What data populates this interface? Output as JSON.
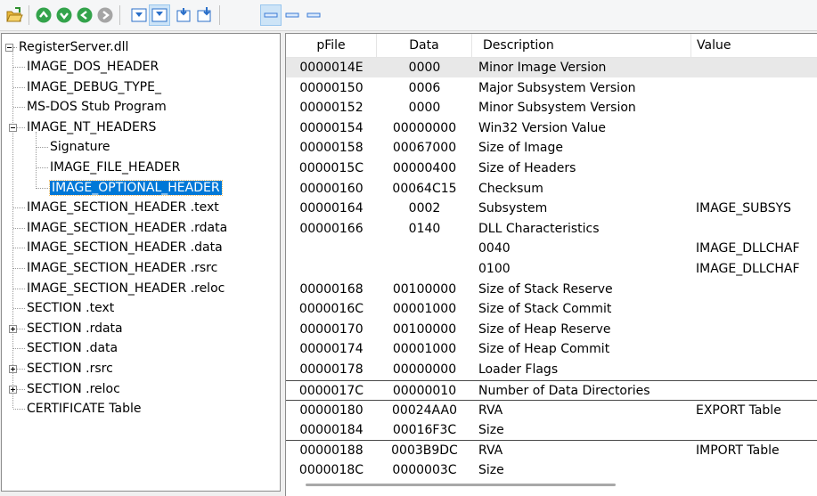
{
  "toolbar": {
    "buttons": [
      {
        "name": "open-folder-icon"
      },
      {
        "name": "nav-first-icon",
        "color": "#2ea043"
      },
      {
        "name": "nav-back-icon",
        "color": "#2ea043"
      },
      {
        "name": "nav-forward-icon",
        "color": "#2ea043"
      },
      {
        "name": "nav-last-icon",
        "color": "#9e9e9e"
      },
      {
        "name": "view-list-icon"
      },
      {
        "name": "view-detail-icon"
      },
      {
        "name": "view-hex-icon"
      },
      {
        "name": "view-download-icon"
      },
      {
        "name": "view-bytes-icon"
      },
      {
        "name": "view-word-icon"
      },
      {
        "name": "view-dword-icon"
      }
    ]
  },
  "tree": {
    "root": "RegisterServer.dll",
    "items": [
      {
        "label": "IMAGE_DOS_HEADER"
      },
      {
        "label": "IMAGE_DEBUG_TYPE_"
      },
      {
        "label": "MS-DOS Stub Program"
      },
      {
        "label": "IMAGE_NT_HEADERS",
        "expanded": true
      },
      {
        "label": "Signature"
      },
      {
        "label": "IMAGE_FILE_HEADER"
      },
      {
        "label": "IMAGE_OPTIONAL_HEADER",
        "selected": true
      },
      {
        "label": "IMAGE_SECTION_HEADER .text"
      },
      {
        "label": "IMAGE_SECTION_HEADER .rdata"
      },
      {
        "label": "IMAGE_SECTION_HEADER .data"
      },
      {
        "label": "IMAGE_SECTION_HEADER .rsrc"
      },
      {
        "label": "IMAGE_SECTION_HEADER .reloc"
      },
      {
        "label": "SECTION .text"
      },
      {
        "label": "SECTION .rdata",
        "expandable": true
      },
      {
        "label": "SECTION .data"
      },
      {
        "label": "SECTION .rsrc",
        "expandable": true
      },
      {
        "label": "SECTION .reloc",
        "expandable": true
      },
      {
        "label": "CERTIFICATE Table"
      }
    ]
  },
  "list": {
    "columns": [
      "pFile",
      "Data",
      "Description",
      "Value"
    ],
    "rows": [
      {
        "pfile": "0000014E",
        "data": "0000",
        "desc": "Minor Image Version",
        "value": ""
      },
      {
        "pfile": "00000150",
        "data": "0006",
        "desc": "Major Subsystem Version",
        "value": ""
      },
      {
        "pfile": "00000152",
        "data": "0000",
        "desc": "Minor Subsystem Version",
        "value": ""
      },
      {
        "pfile": "00000154",
        "data": "00000000",
        "desc": "Win32 Version Value",
        "value": ""
      },
      {
        "pfile": "00000158",
        "data": "00067000",
        "desc": "Size of Image",
        "value": ""
      },
      {
        "pfile": "0000015C",
        "data": "00000400",
        "desc": "Size of Headers",
        "value": ""
      },
      {
        "pfile": "00000160",
        "data": "00064C15",
        "desc": "Checksum",
        "value": ""
      },
      {
        "pfile": "00000164",
        "data": "0002",
        "desc": "Subsystem",
        "value": "IMAGE_SUBSYS"
      },
      {
        "pfile": "00000166",
        "data": "0140",
        "desc": "DLL Characteristics",
        "value": ""
      },
      {
        "pfile": "",
        "data": "",
        "desc": "0040",
        "value": "IMAGE_DLLCHAF"
      },
      {
        "pfile": "",
        "data": "",
        "desc": "0100",
        "value": "IMAGE_DLLCHAF"
      },
      {
        "pfile": "00000168",
        "data": "00100000",
        "desc": "Size of Stack Reserve",
        "value": ""
      },
      {
        "pfile": "0000016C",
        "data": "00001000",
        "desc": "Size of Stack Commit",
        "value": ""
      },
      {
        "pfile": "00000170",
        "data": "00100000",
        "desc": "Size of Heap Reserve",
        "value": ""
      },
      {
        "pfile": "00000174",
        "data": "00001000",
        "desc": "Size of Heap Commit",
        "value": ""
      },
      {
        "pfile": "00000178",
        "data": "00000000",
        "desc": "Loader Flags",
        "value": ""
      },
      {
        "pfile": "0000017C",
        "data": "00000010",
        "desc": "Number of Data Directories",
        "value": ""
      },
      {
        "pfile": "00000180",
        "data": "00024AA0",
        "desc": "RVA",
        "value": "EXPORT Table"
      },
      {
        "pfile": "00000184",
        "data": "00016F3C",
        "desc": "Size",
        "value": ""
      },
      {
        "pfile": "00000188",
        "data": "0003B9DC",
        "desc": "RVA",
        "value": "IMPORT Table"
      },
      {
        "pfile": "0000018C",
        "data": "0000003C",
        "desc": "Size",
        "value": ""
      }
    ],
    "highlighted_row": 0
  }
}
